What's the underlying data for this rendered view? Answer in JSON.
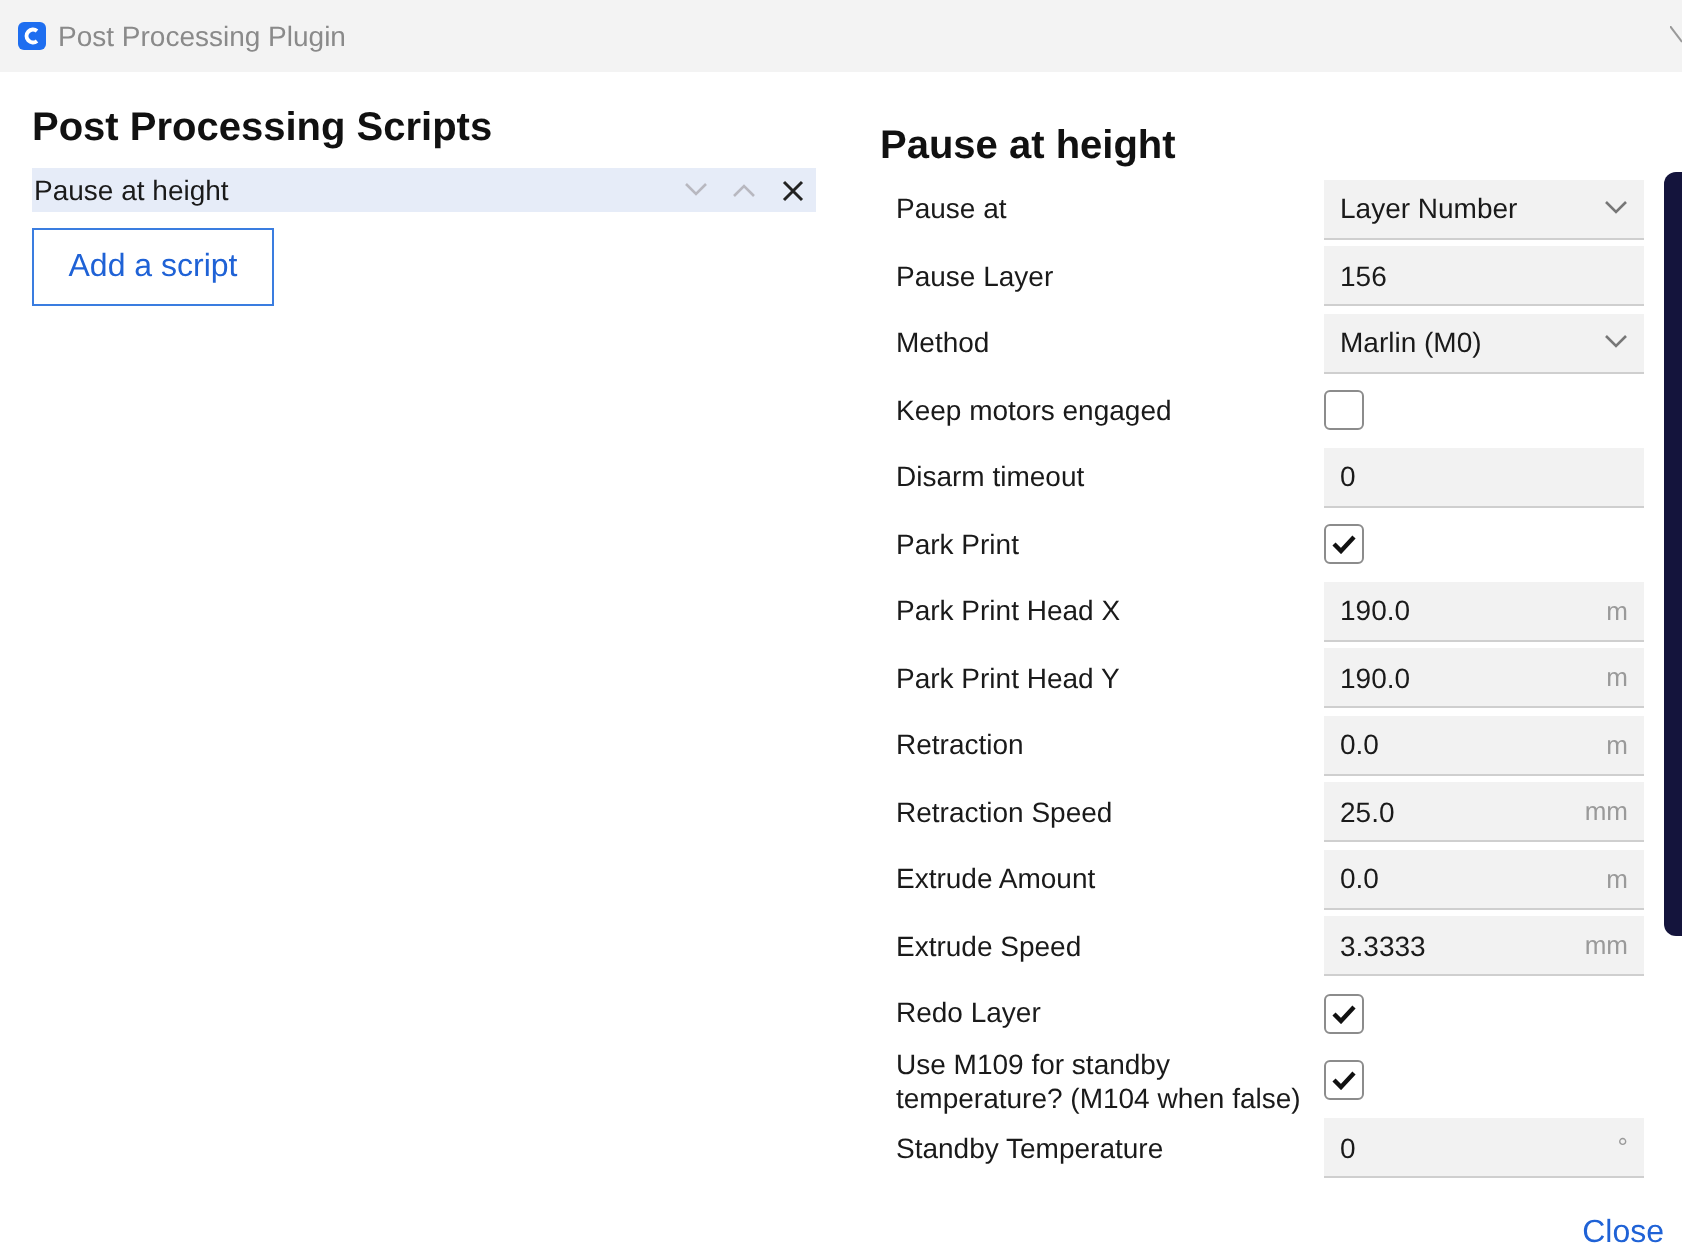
{
  "window": {
    "title": "Post Processing Plugin"
  },
  "scripts_panel": {
    "heading": "Post Processing Scripts",
    "scripts": [
      {
        "name": "Pause at height",
        "selected": true
      }
    ],
    "add_button": "Add a script"
  },
  "settings_panel": {
    "heading": "Pause at height",
    "settings": [
      {
        "label": "Pause at",
        "kind": "dropdown",
        "value": "Layer Number"
      },
      {
        "label": "Pause Layer",
        "kind": "text",
        "value": "156"
      },
      {
        "label": "Method",
        "kind": "dropdown",
        "value": "Marlin (M0)"
      },
      {
        "label": "Keep motors engaged",
        "kind": "checkbox",
        "checked": false
      },
      {
        "label": "Disarm timeout",
        "kind": "text",
        "value": "0"
      },
      {
        "label": "Park Print",
        "kind": "checkbox",
        "checked": true
      },
      {
        "label": "Park Print Head X",
        "kind": "text",
        "value": "190.0",
        "unit": "m"
      },
      {
        "label": "Park Print Head Y",
        "kind": "text",
        "value": "190.0",
        "unit": "m"
      },
      {
        "label": "Retraction",
        "kind": "text",
        "value": "0.0",
        "unit": "m"
      },
      {
        "label": "Retraction Speed",
        "kind": "text",
        "value": "25.0",
        "unit": "mm"
      },
      {
        "label": "Extrude Amount",
        "kind": "text",
        "value": "0.0",
        "unit": "m"
      },
      {
        "label": "Extrude Speed",
        "kind": "text",
        "value": "3.3333",
        "unit": "mm"
      },
      {
        "label": "Redo Layer",
        "kind": "checkbox",
        "checked": true
      },
      {
        "label": "Use M109 for standby temperature? (M104 when false)",
        "kind": "checkbox",
        "checked": true
      },
      {
        "label": "Standby Temperature",
        "kind": "text",
        "value": "0",
        "unit": "°"
      }
    ]
  },
  "footer": {
    "close": "Close"
  }
}
